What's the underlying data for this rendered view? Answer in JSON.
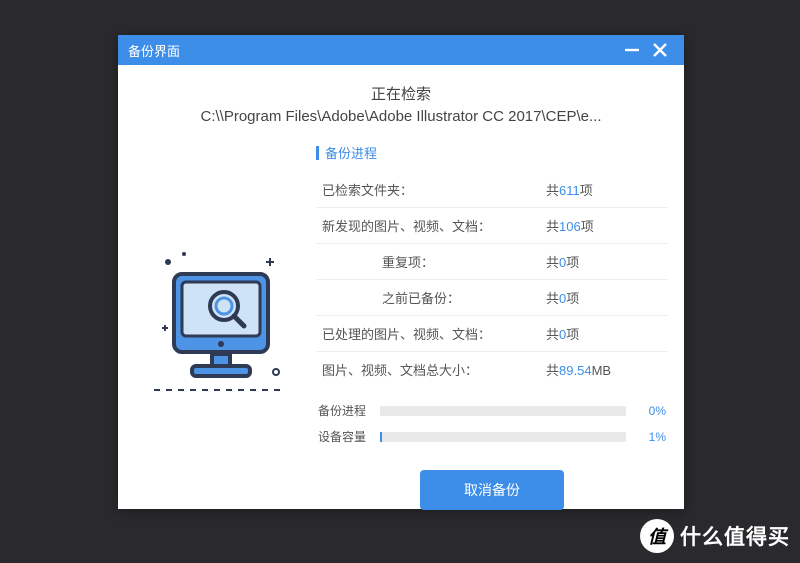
{
  "titlebar": {
    "title": "备份界面"
  },
  "header": {
    "status": "正在检索",
    "path": "C:\\\\Program Files\\Adobe\\Adobe Illustrator CC 2017\\CEP\\e..."
  },
  "section": {
    "title": "备份进程"
  },
  "rows": {
    "scanned": {
      "label": "已检索文件夹：",
      "prefix": "共",
      "num": "611",
      "suffix": "项"
    },
    "found": {
      "label": "新发现的图片、视频、文档：",
      "prefix": "共",
      "num": "106",
      "suffix": "项"
    },
    "dup": {
      "label": "重复项：",
      "prefix": "共",
      "num": "0",
      "suffix": "项"
    },
    "prev": {
      "label": "之前已备份：",
      "prefix": "共",
      "num": "0",
      "suffix": "项"
    },
    "done": {
      "label": "已处理的图片、视频、文档：",
      "prefix": "共",
      "num": "0",
      "suffix": "项"
    },
    "size": {
      "label": "图片、视频、文档总大小：",
      "prefix": "共",
      "num": "89.54",
      "suffix": "MB"
    }
  },
  "progress": {
    "backup": {
      "label": "备份进程",
      "pct": "0%",
      "width": "0%"
    },
    "device": {
      "label": "设备容量",
      "pct": "1%",
      "width": "1%"
    }
  },
  "button": {
    "cancel": "取消备份"
  },
  "watermark": {
    "badge": "值",
    "text": "什么值得买"
  }
}
